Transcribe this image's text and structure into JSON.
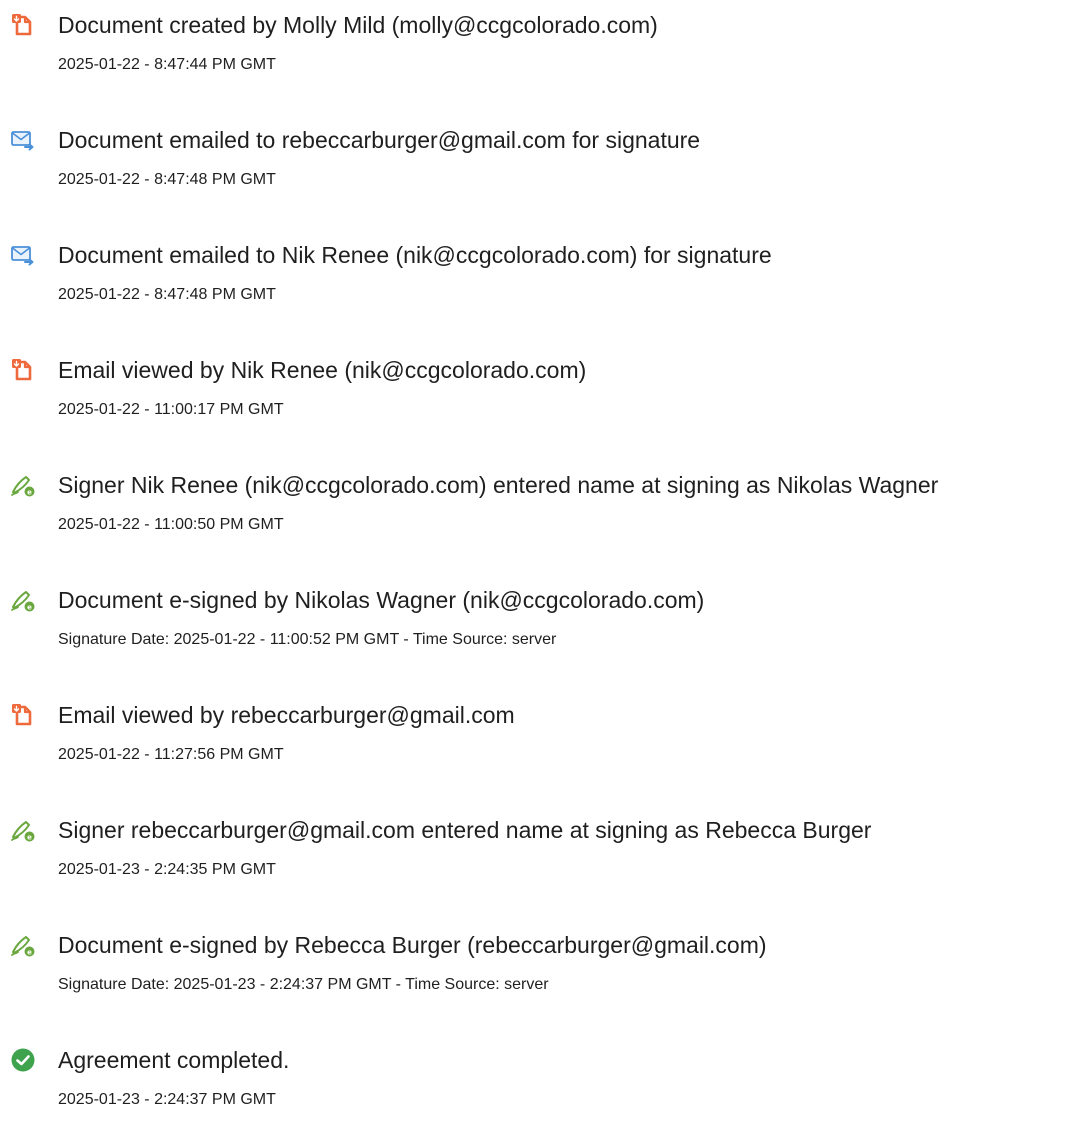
{
  "colors": {
    "document_icon": "#ee6a3c",
    "email_icon": "#4a90d9",
    "sign_icon": "#6aa83f",
    "complete_icon": "#3fa34d"
  },
  "events": [
    {
      "icon": "document-icon",
      "title": "Document created by Molly Mild (molly@ccgcolorado.com)",
      "time": "2025-01-22 - 8:47:44 PM GMT"
    },
    {
      "icon": "email-send-icon",
      "title": "Document emailed to rebeccarburger@gmail.com for signature",
      "time": "2025-01-22 - 8:47:48 PM GMT"
    },
    {
      "icon": "email-send-icon",
      "title": "Document emailed to Nik Renee (nik@ccgcolorado.com) for signature",
      "time": "2025-01-22 - 8:47:48 PM GMT"
    },
    {
      "icon": "document-icon",
      "title": "Email viewed by Nik Renee (nik@ccgcolorado.com)",
      "time": "2025-01-22 - 11:00:17 PM GMT"
    },
    {
      "icon": "esign-pen-icon",
      "title": "Signer Nik Renee (nik@ccgcolorado.com) entered name at signing as Nikolas Wagner",
      "time": "2025-01-22 - 11:00:50 PM GMT"
    },
    {
      "icon": "esign-pen-icon",
      "title": "Document e-signed by Nikolas Wagner (nik@ccgcolorado.com)",
      "time": "Signature Date: 2025-01-22 - 11:00:52 PM GMT - Time Source: server"
    },
    {
      "icon": "document-icon",
      "title": "Email viewed by rebeccarburger@gmail.com",
      "time": "2025-01-22 - 11:27:56 PM GMT"
    },
    {
      "icon": "esign-pen-icon",
      "title": "Signer rebeccarburger@gmail.com entered name at signing as Rebecca Burger",
      "time": "2025-01-23 - 2:24:35 PM GMT"
    },
    {
      "icon": "esign-pen-icon",
      "title": "Document e-signed by Rebecca Burger (rebeccarburger@gmail.com)",
      "time": "Signature Date: 2025-01-23 - 2:24:37 PM GMT - Time Source: server"
    },
    {
      "icon": "check-circle-icon",
      "title": "Agreement completed.",
      "time": "2025-01-23 - 2:24:37 PM GMT"
    }
  ]
}
